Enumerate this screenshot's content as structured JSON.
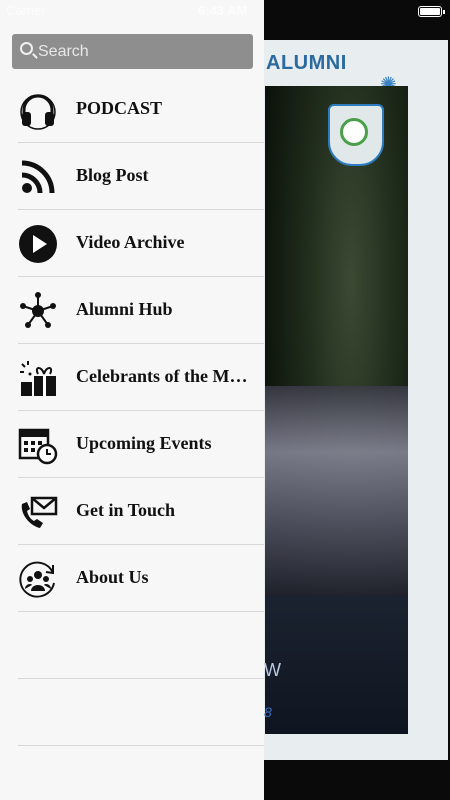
{
  "status_bar": {
    "carrier": "Carrier",
    "time": "6:43 AM"
  },
  "main": {
    "title": "ALUMNI",
    "hero_text_line1": "W",
    "hero_text_line2": "8"
  },
  "drawer": {
    "search": {
      "placeholder": "Search",
      "value": ""
    },
    "items": [
      {
        "label": "PODCAST",
        "icon": "headphones-icon"
      },
      {
        "label": "Blog Post",
        "icon": "rss-feed-icon"
      },
      {
        "label": "Video Archive",
        "icon": "play-icon"
      },
      {
        "label": "Alumni Hub",
        "icon": "network-hub-icon"
      },
      {
        "label": "Celebrants of the Month",
        "icon": "gift-icon"
      },
      {
        "label": "Upcoming Events",
        "icon": "calendar-clock-icon"
      },
      {
        "label": "Get in Touch",
        "icon": "phone-mail-icon"
      },
      {
        "label": "About Us",
        "icon": "group-refresh-icon"
      }
    ]
  }
}
